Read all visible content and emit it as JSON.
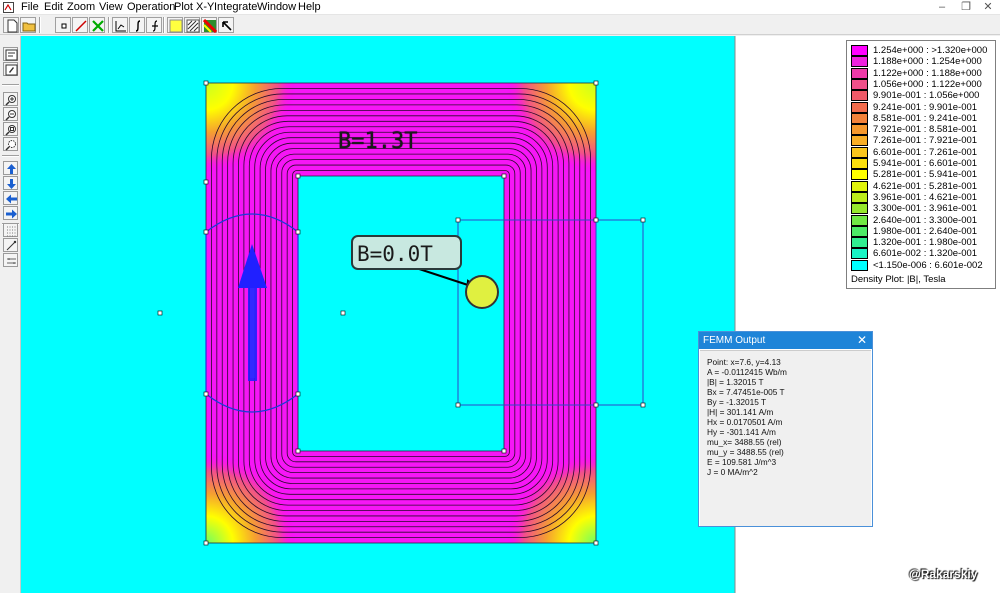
{
  "menu": {
    "items": [
      "File",
      "Edit",
      "Zoom",
      "View",
      "Operation",
      "Plot X-Y",
      "Integrate",
      "Window",
      "Help"
    ],
    "window_controls": [
      "–",
      "❐",
      "✕"
    ]
  },
  "canvas": {
    "annotation_flux": "B=1.3T",
    "annotation_point": "B=0.0T",
    "colors": {
      "background": "#00ffff",
      "core_high": "#ff00ff",
      "core_mid": "#e040e0",
      "corner_yellow": "#ffff00",
      "arrow": "#2020ff",
      "point_marker": "#e8f040"
    }
  },
  "legend": {
    "rows": [
      {
        "color": "#ff00ff",
        "label": "1.254e+000 : >1.320e+000"
      },
      {
        "color": "#ee22dd",
        "label": "1.188e+000 : 1.254e+000"
      },
      {
        "color": "#ee3aa8",
        "label": "1.122e+000 : 1.188e+000"
      },
      {
        "color": "#f0508a",
        "label": "1.056e+000 : 1.122e+000"
      },
      {
        "color": "#f05a68",
        "label": "9.901e-001 : 1.056e+000"
      },
      {
        "color": "#f26c4c",
        "label": "9.241e-001 : 9.901e-001"
      },
      {
        "color": "#f3823a",
        "label": "8.581e-001 : 9.241e-001"
      },
      {
        "color": "#f6982c",
        "label": "7.921e-001 : 8.581e-001"
      },
      {
        "color": "#f8ae26",
        "label": "7.261e-001 : 7.921e-001"
      },
      {
        "color": "#fbc61c",
        "label": "6.601e-001 : 7.261e-001"
      },
      {
        "color": "#fde00e",
        "label": "5.941e-001 : 6.601e-001"
      },
      {
        "color": "#ffff00",
        "label": "5.281e-001 : 5.941e-001"
      },
      {
        "color": "#e0f40c",
        "label": "4.621e-001 : 5.281e-001"
      },
      {
        "color": "#bcec1a",
        "label": "3.961e-001 : 4.621e-001"
      },
      {
        "color": "#96e82c",
        "label": "3.300e-001 : 3.961e-001"
      },
      {
        "color": "#70e844",
        "label": "2.640e-001 : 3.300e-001"
      },
      {
        "color": "#4cea66",
        "label": "1.980e-001 : 2.640e-001"
      },
      {
        "color": "#30ee90",
        "label": "1.320e-001 : 1.980e-001"
      },
      {
        "color": "#18f4c4",
        "label": "6.601e-002 : 1.320e-001"
      },
      {
        "color": "#00ffff",
        "label": "<1.150e-006 : 6.601e-002"
      }
    ],
    "caption": "Density Plot: |B|, Tesla"
  },
  "output": {
    "title": "FEMM Output",
    "lines": [
      "Point: x=7.6, y=4.13",
      "A   = -0.0112415 Wb/m",
      "|B| = 1.32015 T",
      "Bx  = 7.47451e-005 T",
      "By  = -1.32015 T",
      "|H| = 301.141 A/m",
      "Hx  = 0.0170501 A/m",
      "Hy  = -301.141 A/m",
      "mu_x= 3488.55 (rel)",
      "mu_y = 3488.55 (rel)",
      "E   = 109.581 J/m^3",
      "J   = 0 MA/m^2"
    ]
  },
  "watermark": "@Rakarskiy"
}
